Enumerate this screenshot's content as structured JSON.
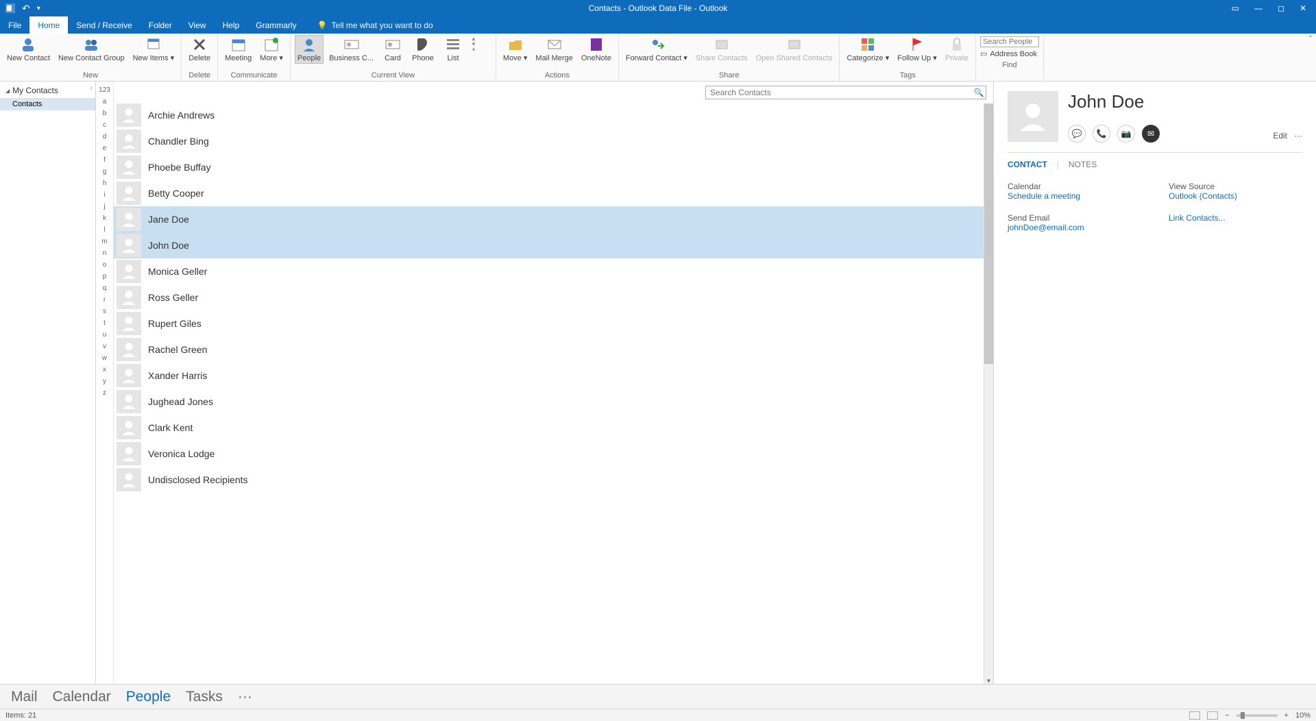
{
  "title": "Contacts - Outlook Data File  -  Outlook",
  "tabs": [
    "File",
    "Home",
    "Send / Receive",
    "Folder",
    "View",
    "Help",
    "Grammarly"
  ],
  "active_tab": "Home",
  "tell_me": "Tell me what you want to do",
  "ribbon": {
    "new": {
      "label": "New",
      "btns": [
        "New Contact",
        "New Contact Group",
        "New Items ▾"
      ]
    },
    "delete": {
      "label": "Delete",
      "btns": [
        "Delete"
      ]
    },
    "communicate": {
      "label": "Communicate",
      "btns": [
        "Meeting",
        "More ▾"
      ]
    },
    "view": {
      "label": "Current View",
      "btns": [
        "People",
        "Business C...",
        "Card",
        "Phone",
        "List"
      ]
    },
    "actions": {
      "label": "Actions",
      "btns": [
        "Move ▾",
        "Mail Merge",
        "OneNote"
      ]
    },
    "share": {
      "label": "Share",
      "btns": [
        "Forward Contact ▾",
        "Share Contacts",
        "Open Shared Contacts"
      ]
    },
    "tags": {
      "label": "Tags",
      "btns": [
        "Categorize ▾",
        "Follow Up ▾",
        "Private"
      ]
    },
    "find": {
      "label": "Find",
      "search_placeholder": "Search People",
      "address_book": "Address Book"
    }
  },
  "nav": {
    "header": "My Contacts",
    "items": [
      "Contacts"
    ]
  },
  "alpha": [
    "123",
    "a",
    "b",
    "c",
    "d",
    "e",
    "f",
    "g",
    "h",
    "i",
    "j",
    "k",
    "l",
    "m",
    "n",
    "o",
    "p",
    "q",
    "r",
    "s",
    "t",
    "u",
    "v",
    "w",
    "x",
    "y",
    "z"
  ],
  "search_contacts_placeholder": "Search Contacts",
  "contacts": [
    {
      "name": "Archie Andrews",
      "sel": false
    },
    {
      "name": "Chandler Bing",
      "sel": false
    },
    {
      "name": "Phoebe Buffay",
      "sel": false
    },
    {
      "name": "Betty Cooper",
      "sel": false
    },
    {
      "name": "Jane Doe",
      "sel": true
    },
    {
      "name": "John Doe",
      "sel": true
    },
    {
      "name": "Monica Geller",
      "sel": false
    },
    {
      "name": "Ross Geller",
      "sel": false
    },
    {
      "name": "Rupert Giles",
      "sel": false
    },
    {
      "name": "Rachel Green",
      "sel": false
    },
    {
      "name": "Xander Harris",
      "sel": false
    },
    {
      "name": "Jughead Jones",
      "sel": false
    },
    {
      "name": "Clark Kent",
      "sel": false
    },
    {
      "name": "Veronica Lodge",
      "sel": false
    },
    {
      "name": "Undisclosed Recipients",
      "sel": false
    }
  ],
  "detail": {
    "name": "John Doe",
    "edit": "Edit",
    "tabs": [
      "CONTACT",
      "NOTES"
    ],
    "calendar_lbl": "Calendar",
    "schedule": "Schedule a meeting",
    "send_email_lbl": "Send Email",
    "email": "johnDoe@email.com",
    "view_source_lbl": "View Source",
    "source": "Outlook (Contacts)",
    "link": "Link Contacts..."
  },
  "navbar": [
    "Mail",
    "Calendar",
    "People",
    "Tasks",
    "···"
  ],
  "navbar_active": "People",
  "status": {
    "items": "Items: 21",
    "zoom": "10%"
  }
}
